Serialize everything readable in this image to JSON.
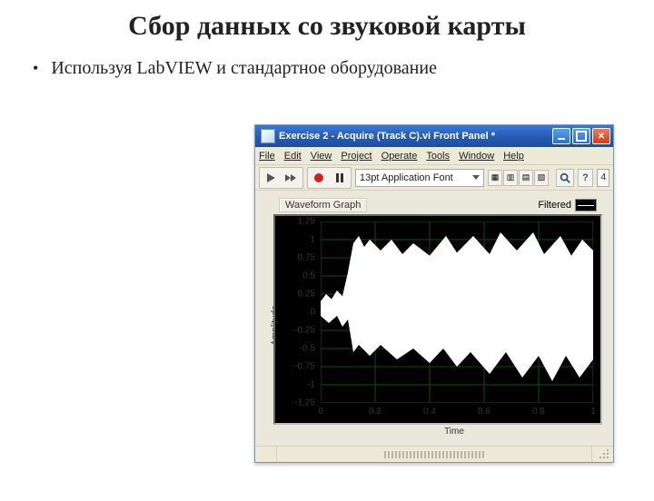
{
  "slide": {
    "title": "Сбор данных со звуковой карты",
    "bullet": "Используя LabVIEW  и стандартное оборудование"
  },
  "window": {
    "title": "Exercise 2 - Acquire (Track C).vi Front Panel *",
    "menu": [
      "File",
      "Edit",
      "View",
      "Project",
      "Operate",
      "Tools",
      "Window",
      "Help"
    ],
    "font_selector": "13pt Application Font",
    "frame_index": "4",
    "graph_label": "Waveform Graph",
    "legend_label": "Filtered",
    "ylabel": "Amplitude",
    "xlabel": "Time"
  },
  "chart_data": {
    "type": "line",
    "title": "Waveform Graph",
    "xlabel": "Time",
    "ylabel": "Amplitude",
    "xlim": [
      0,
      1
    ],
    "ylim": [
      -1.25,
      1.25
    ],
    "xticks": [
      0,
      0.2,
      0.4,
      0.6,
      0.8,
      1
    ],
    "yticks": [
      -1.25,
      -1,
      -0.75,
      -0.5,
      -0.25,
      0,
      0.25,
      0.5,
      0.75,
      1,
      1.25
    ],
    "series": [
      {
        "name": "Filtered",
        "envelope_upper": [
          {
            "x": 0.0,
            "y": 0.15
          },
          {
            "x": 0.02,
            "y": 0.25
          },
          {
            "x": 0.04,
            "y": 0.18
          },
          {
            "x": 0.06,
            "y": 0.3
          },
          {
            "x": 0.08,
            "y": 0.22
          },
          {
            "x": 0.1,
            "y": 0.55
          },
          {
            "x": 0.12,
            "y": 0.95
          },
          {
            "x": 0.14,
            "y": 1.05
          },
          {
            "x": 0.16,
            "y": 0.9
          },
          {
            "x": 0.18,
            "y": 1.0
          },
          {
            "x": 0.22,
            "y": 0.85
          },
          {
            "x": 0.26,
            "y": 1.0
          },
          {
            "x": 0.3,
            "y": 0.8
          },
          {
            "x": 0.34,
            "y": 0.95
          },
          {
            "x": 0.4,
            "y": 0.78
          },
          {
            "x": 0.46,
            "y": 1.05
          },
          {
            "x": 0.5,
            "y": 0.82
          },
          {
            "x": 0.56,
            "y": 1.05
          },
          {
            "x": 0.62,
            "y": 0.8
          },
          {
            "x": 0.66,
            "y": 1.1
          },
          {
            "x": 0.72,
            "y": 0.85
          },
          {
            "x": 0.78,
            "y": 1.1
          },
          {
            "x": 0.82,
            "y": 0.8
          },
          {
            "x": 0.88,
            "y": 1.05
          },
          {
            "x": 0.92,
            "y": 0.78
          },
          {
            "x": 0.96,
            "y": 1.0
          },
          {
            "x": 1.0,
            "y": 0.85
          }
        ],
        "envelope_lower": [
          {
            "x": 0.0,
            "y": -0.05
          },
          {
            "x": 0.03,
            "y": -0.15
          },
          {
            "x": 0.06,
            "y": -0.05
          },
          {
            "x": 0.08,
            "y": -0.2
          },
          {
            "x": 0.1,
            "y": -0.1
          },
          {
            "x": 0.12,
            "y": -0.55
          },
          {
            "x": 0.14,
            "y": -0.45
          },
          {
            "x": 0.18,
            "y": -0.6
          },
          {
            "x": 0.22,
            "y": -0.45
          },
          {
            "x": 0.28,
            "y": -0.65
          },
          {
            "x": 0.34,
            "y": -0.5
          },
          {
            "x": 0.4,
            "y": -0.7
          },
          {
            "x": 0.45,
            "y": -0.5
          },
          {
            "x": 0.5,
            "y": -0.75
          },
          {
            "x": 0.55,
            "y": -0.55
          },
          {
            "x": 0.62,
            "y": -0.85
          },
          {
            "x": 0.68,
            "y": -0.55
          },
          {
            "x": 0.74,
            "y": -0.9
          },
          {
            "x": 0.8,
            "y": -0.6
          },
          {
            "x": 0.85,
            "y": -0.95
          },
          {
            "x": 0.9,
            "y": -0.6
          },
          {
            "x": 0.95,
            "y": -0.9
          },
          {
            "x": 1.0,
            "y": -0.65
          }
        ]
      }
    ]
  }
}
